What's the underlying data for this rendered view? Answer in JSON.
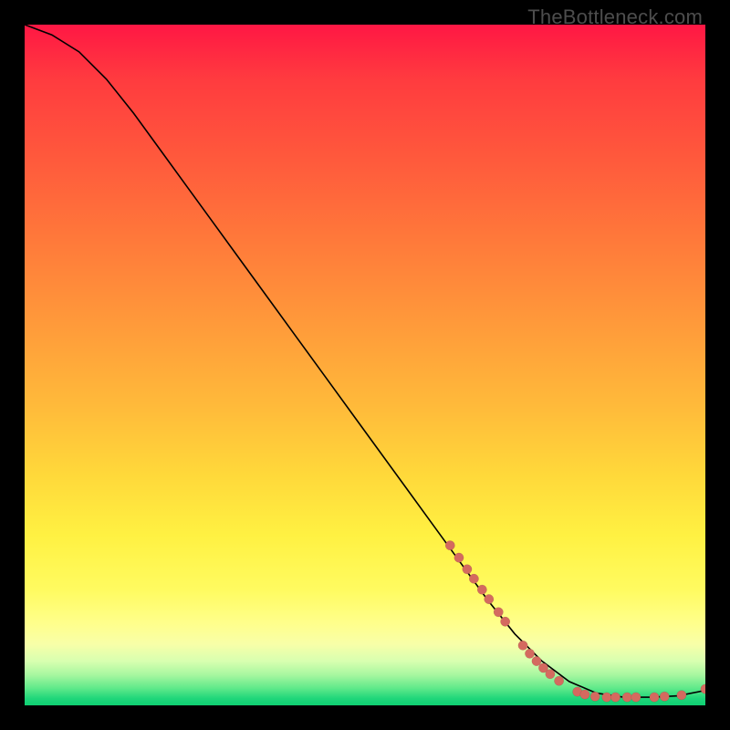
{
  "watermark": "TheBottleneck.com",
  "colors": {
    "page_bg": "#000000",
    "curve": "#000000",
    "marker": "#d46a5f"
  },
  "chart_data": {
    "type": "line",
    "xlim": [
      0,
      100
    ],
    "ylim": [
      0,
      100
    ],
    "xlabel": "",
    "ylabel": "",
    "title": "",
    "grid": false,
    "legend": false,
    "series": [
      {
        "name": "curve",
        "x": [
          0,
          4,
          8,
          12,
          16,
          20,
          24,
          28,
          32,
          36,
          40,
          44,
          48,
          52,
          56,
          60,
          64,
          68,
          72,
          76,
          80,
          84,
          88,
          92,
          96,
          100
        ],
        "y": [
          100,
          98.5,
          96,
          92,
          87,
          81.5,
          76,
          70.5,
          65,
          59.5,
          54,
          48.5,
          43,
          37.5,
          32,
          26.5,
          21,
          15.5,
          10.5,
          6.5,
          3.5,
          1.8,
          1.2,
          1.2,
          1.4,
          2.2
        ]
      }
    ],
    "markers": [
      {
        "x": 62.5,
        "y": 23.5
      },
      {
        "x": 63.8,
        "y": 21.7
      },
      {
        "x": 65.0,
        "y": 20.0
      },
      {
        "x": 66.0,
        "y": 18.6
      },
      {
        "x": 67.2,
        "y": 17.0
      },
      {
        "x": 68.2,
        "y": 15.6
      },
      {
        "x": 69.6,
        "y": 13.7
      },
      {
        "x": 70.6,
        "y": 12.3
      },
      {
        "x": 73.2,
        "y": 8.8
      },
      {
        "x": 74.2,
        "y": 7.6
      },
      {
        "x": 75.2,
        "y": 6.5
      },
      {
        "x": 76.2,
        "y": 5.5
      },
      {
        "x": 77.2,
        "y": 4.6
      },
      {
        "x": 78.5,
        "y": 3.6
      },
      {
        "x": 81.2,
        "y": 2.0
      },
      {
        "x": 82.3,
        "y": 1.6
      },
      {
        "x": 83.8,
        "y": 1.3
      },
      {
        "x": 85.5,
        "y": 1.2
      },
      {
        "x": 86.8,
        "y": 1.2
      },
      {
        "x": 88.5,
        "y": 1.2
      },
      {
        "x": 89.8,
        "y": 1.2
      },
      {
        "x": 92.5,
        "y": 1.2
      },
      {
        "x": 94.0,
        "y": 1.3
      },
      {
        "x": 96.5,
        "y": 1.5
      },
      {
        "x": 100.0,
        "y": 2.4
      }
    ]
  }
}
